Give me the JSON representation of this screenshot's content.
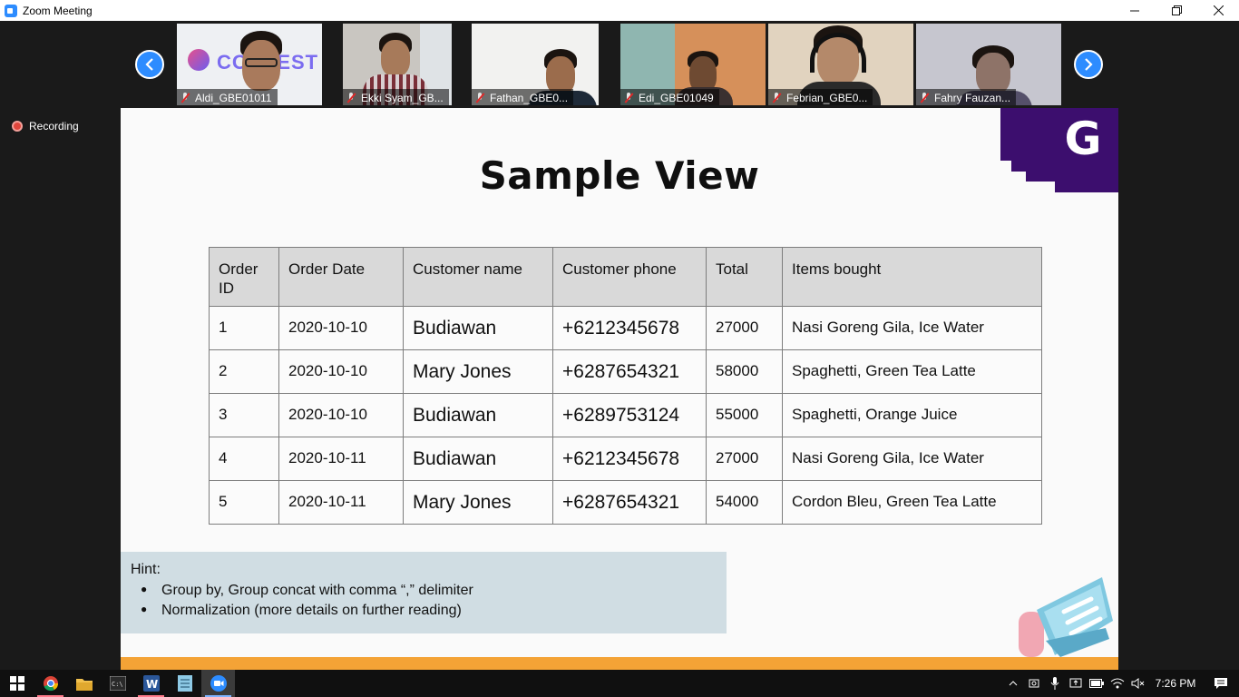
{
  "window": {
    "title": "Zoom Meeting",
    "controls": [
      "minimize",
      "restore",
      "close"
    ]
  },
  "participants": [
    {
      "name": "Aldi_GBE01011",
      "bg": "#eef0f3",
      "face": "#a97a5c",
      "logo_text": "CONTEST"
    },
    {
      "name": "Ekki Syam_GB...",
      "bg": "#c9c6c1",
      "face": "#a77a5a"
    },
    {
      "name": "Fathan_GBE0...",
      "bg": "#f2f2f0",
      "face": "#9b6c4c"
    },
    {
      "name": "Edi_GBE01049",
      "bg": "#d6905a",
      "face": "#6e4a32"
    },
    {
      "name": "Febrian_GBE0...",
      "bg": "#e1d3bf",
      "face": "#b4896a"
    },
    {
      "name": "Fahry Fauzan...",
      "bg": "#c6c6cf",
      "face": "#8e7368"
    }
  ],
  "navigation": {
    "prev": "previous-page",
    "next": "next-page"
  },
  "recording": {
    "label": "Recording"
  },
  "slide": {
    "title": "Sample View",
    "logo_letter": "G",
    "table": {
      "headers": [
        "Order ID",
        "Order Date",
        "Customer name",
        "Customer phone",
        "Total",
        "Items bought"
      ],
      "rows": [
        [
          "1",
          "2020-10-10",
          "Budiawan",
          "+6212345678",
          "27000",
          "Nasi Goreng Gila, Ice Water"
        ],
        [
          "2",
          "2020-10-10",
          "Mary Jones",
          "+6287654321",
          "58000",
          "Spaghetti, Green Tea Latte"
        ],
        [
          "3",
          "2020-10-10",
          "Budiawan",
          "+6289753124",
          "55000",
          "Spaghetti, Orange Juice"
        ],
        [
          "4",
          "2020-10-11",
          "Budiawan",
          "+6212345678",
          "27000",
          "Nasi Goreng Gila, Ice Water"
        ],
        [
          "5",
          "2020-10-11",
          "Mary Jones",
          "+6287654321",
          "54000",
          "Cordon Bleu, Green Tea Latte"
        ]
      ]
    },
    "hint": {
      "title": "Hint:",
      "items": [
        "Group by, Group concat with comma  “,” delimiter",
        "Normalization (more details on further reading)"
      ]
    },
    "colors": {
      "purple": "#3c0e6e",
      "orange": "#f4a336",
      "hint_bg": "#d0dde3"
    }
  },
  "taskbar": {
    "apps": [
      "start-icon",
      "chrome-icon",
      "file-explorer-icon",
      "cmd-icon",
      "word-icon",
      "notepad-icon",
      "zoom-icon"
    ],
    "clock": "7:26 PM"
  }
}
